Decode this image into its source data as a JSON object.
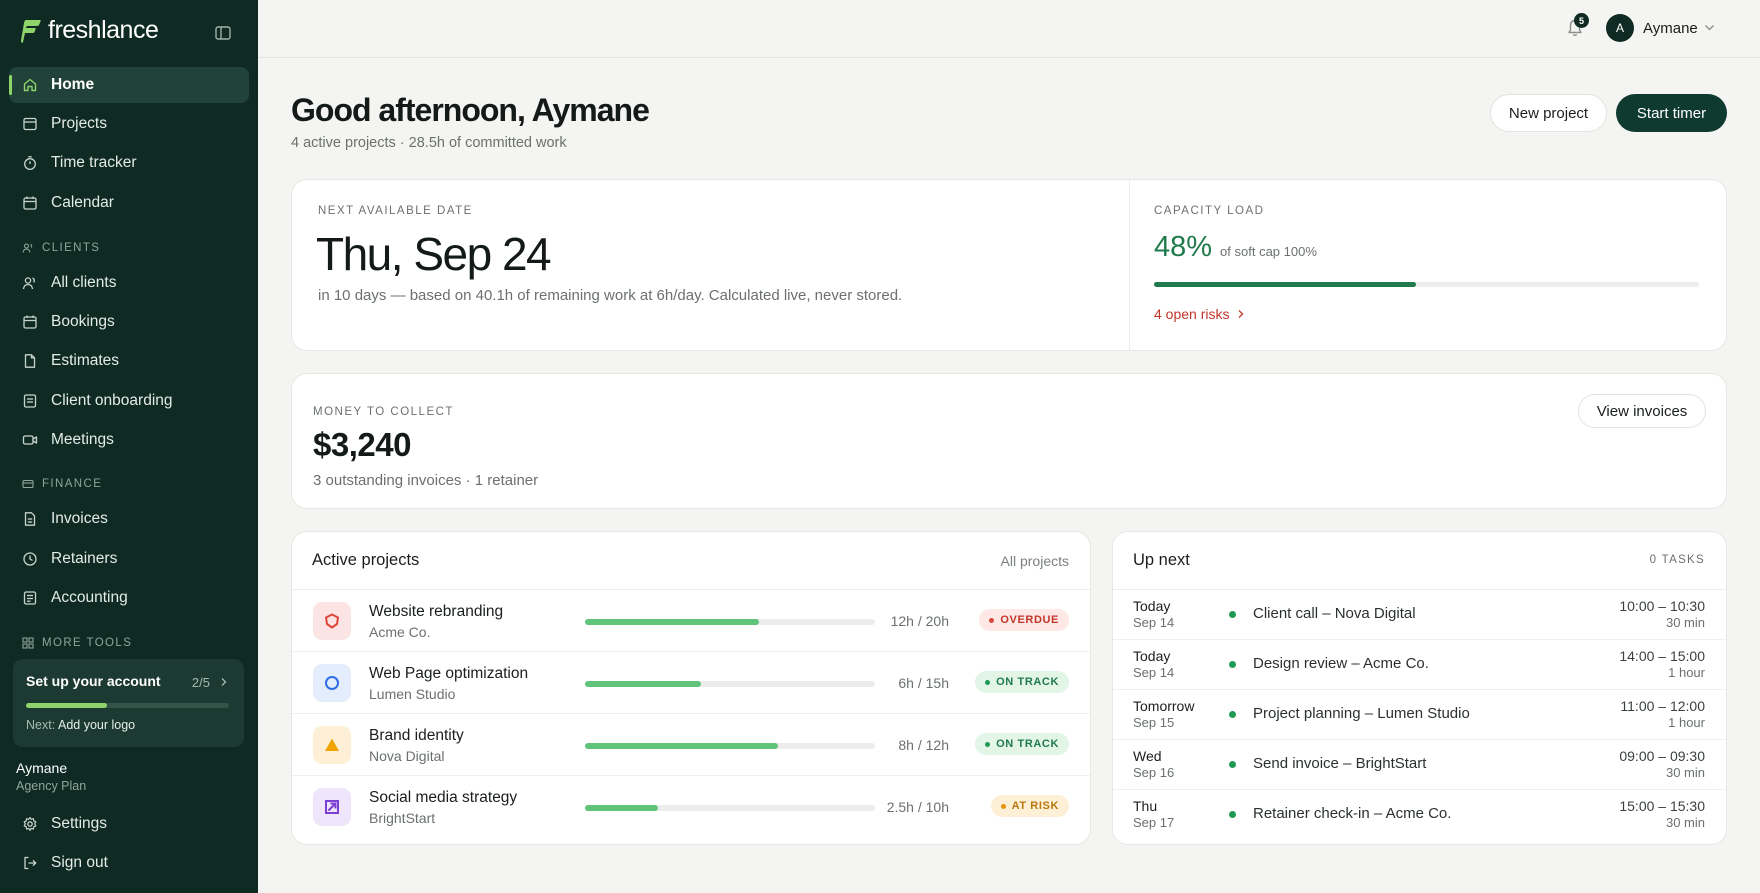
{
  "brand": {
    "name": "freshlance"
  },
  "sidebar": {
    "nav": [
      {
        "label": "Home",
        "icon": "home-icon",
        "active": true
      },
      {
        "label": "Projects",
        "icon": "projects-icon"
      },
      {
        "label": "Time tracker",
        "icon": "timer-icon"
      },
      {
        "label": "Calendar",
        "icon": "calendar-icon"
      }
    ],
    "clients_section": "CLIENTS",
    "clients": [
      {
        "label": "All clients",
        "icon": "users-icon"
      },
      {
        "label": "Bookings",
        "icon": "bookings-icon"
      },
      {
        "label": "Estimates",
        "icon": "document-icon"
      },
      {
        "label": "Client onboarding",
        "icon": "onboarding-icon"
      },
      {
        "label": "Meetings",
        "icon": "video-icon"
      }
    ],
    "finance_section": "FINANCE",
    "finance": [
      {
        "label": "Invoices",
        "icon": "invoice-icon"
      },
      {
        "label": "Retainers",
        "icon": "clock-icon"
      },
      {
        "label": "Accounting",
        "icon": "ledger-icon"
      }
    ],
    "more_section": "MORE TOOLS",
    "setup": {
      "title": "Set up your account",
      "count": "2/5",
      "progress": 0.4,
      "next_label": "Next:",
      "next_value": "Add your logo"
    },
    "user": {
      "name": "Aymane",
      "plan": "Agency Plan"
    },
    "settings": "Settings",
    "signout": "Sign out"
  },
  "topbar": {
    "notifications": "5",
    "avatar_initial": "A",
    "user": "Aymane"
  },
  "header": {
    "greeting": "Good afternoon, Aymane",
    "subline": "4 active projects · 28.5h of committed work",
    "new_project": "New project",
    "start_timer": "Start timer"
  },
  "availability": {
    "label": "NEXT AVAILABLE DATE",
    "date": "Thu, Sep 24",
    "note": "in 10 days — based on 40.1h of remaining work at 6h/day. Calculated live, never stored."
  },
  "capacity": {
    "label": "CAPACITY LOAD",
    "percent": "48%",
    "fraction": 0.48,
    "note": "of soft cap 100%",
    "risks": "4 open risks"
  },
  "money": {
    "label": "MONEY TO COLLECT",
    "amount": "$3,240",
    "note": "3 outstanding invoices · 1 retainer",
    "button": "View invoices"
  },
  "projects": {
    "title": "Active projects",
    "link": "All projects",
    "rows": [
      {
        "name": "Website rebranding",
        "client": "Acme Co.",
        "hours": "12h / 20h",
        "progress": 0.6,
        "status": "OVERDUE",
        "icon": "shield-icon"
      },
      {
        "name": "Web Page optimization",
        "client": "Lumen Studio",
        "hours": "6h / 15h",
        "progress": 0.4,
        "status": "ON TRACK",
        "icon": "circle-icon"
      },
      {
        "name": "Brand identity",
        "client": "Nova Digital",
        "hours": "8h / 12h",
        "progress": 0.6667,
        "status": "ON TRACK",
        "icon": "triangle-icon"
      },
      {
        "name": "Social media strategy",
        "client": "BrightStart",
        "hours": "2.5h / 10h",
        "progress": 0.25,
        "status": "AT RISK",
        "icon": "square-arrow-icon"
      }
    ]
  },
  "upnext": {
    "title": "Up next",
    "count": "0 TASKS",
    "rows": [
      {
        "day": "Today",
        "date": "Sep 14",
        "title": "Client call – Nova Digital",
        "time": "10:00 – 10:30",
        "duration": "30 min"
      },
      {
        "day": "Today",
        "date": "Sep 14",
        "title": "Design review – Acme Co.",
        "time": "14:00 – 15:00",
        "duration": "1 hour"
      },
      {
        "day": "Tomorrow",
        "date": "Sep 15",
        "title": "Project planning – Lumen Studio",
        "time": "11:00 – 12:00",
        "duration": "1 hour"
      },
      {
        "day": "Wed",
        "date": "Sep 16",
        "title": "Send invoice – BrightStart",
        "time": "09:00 – 09:30",
        "duration": "30 min"
      },
      {
        "day": "Thu",
        "date": "Sep 17",
        "title": "Retainer check-in – Acme Co.",
        "time": "15:00 – 15:30",
        "duration": "30 min"
      }
    ]
  },
  "colors": {
    "sidebar": "#0f2a23",
    "accent_green": "#1f7a4c",
    "lime": "#8fd36b",
    "risk_red": "#c2352a"
  }
}
